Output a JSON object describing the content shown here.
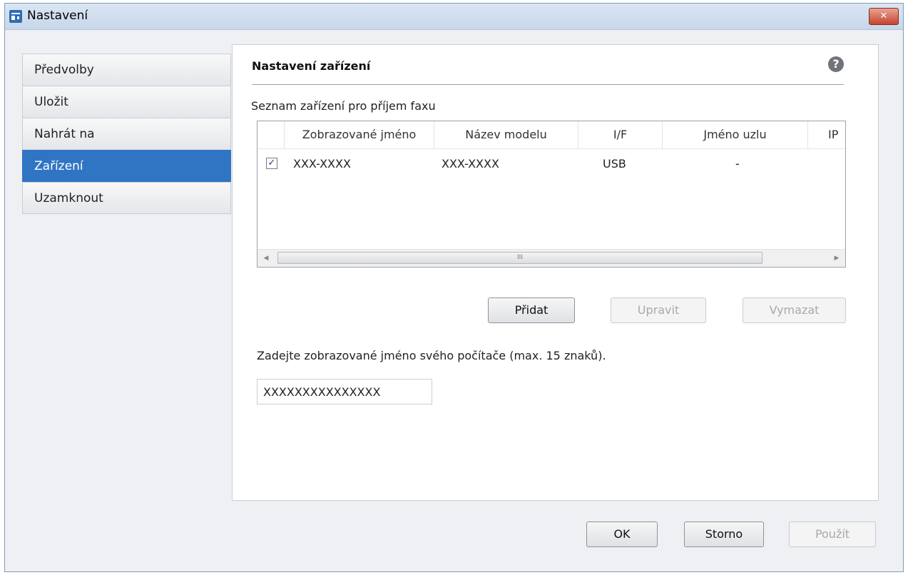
{
  "window": {
    "title": "Nastavení",
    "close_label": "✕"
  },
  "sidebar": {
    "items": [
      {
        "label": "Předvolby"
      },
      {
        "label": "Uložit"
      },
      {
        "label": "Nahrát na"
      },
      {
        "label": "Zařízení"
      },
      {
        "label": "Uzamknout"
      }
    ],
    "active": "Zařízení"
  },
  "panel": {
    "section_title": "Nastavení zařízení",
    "help_label": "?",
    "list_label": "Seznam zařízení pro příjem faxu",
    "columns": [
      "Zobrazované jméno",
      "Název modelu",
      "I/F",
      "Jméno uzlu",
      "IP"
    ],
    "rows": [
      {
        "checked": true,
        "display_name": "XXX-XXXX",
        "model": "XXX-XXXX",
        "interface": "USB",
        "node_name": "-"
      }
    ],
    "scroll_thumb_label": "III",
    "buttons": {
      "add": "Přidat",
      "edit": "Upravit",
      "delete": "Vymazat"
    },
    "name_prompt": "Zadejte zobrazované jméno svého počítače (max. 15 znaků).",
    "name_value": "XXXXXXXXXXXXXXX"
  },
  "footer": {
    "ok": "OK",
    "cancel": "Storno",
    "apply": "Použít"
  },
  "colors": {
    "accent": "#2f75c4",
    "close": "#c7442e"
  }
}
